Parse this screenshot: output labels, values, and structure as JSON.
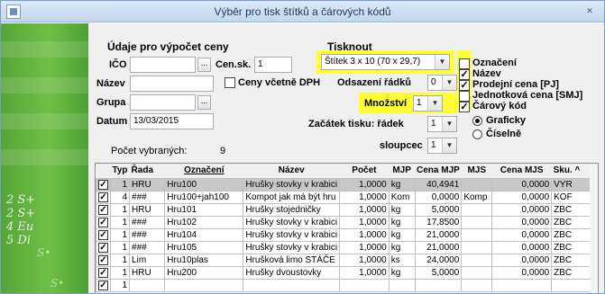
{
  "window": {
    "title": "Výběr pro tisk štítků a čárových kódů",
    "close_icon": "close-icon"
  },
  "left_panel": {
    "heading": "Údaje pro výpočet ceny",
    "ico_label": "IČO",
    "ico_value": "",
    "nazev_label": "Název",
    "nazev_value": "",
    "grupa_label": "Grupa",
    "grupa_value": "",
    "datum_label": "Datum",
    "datum_value": "13/03/2015",
    "browse_label": "...",
    "censk_label": "Cen.sk.",
    "censk_value": "1",
    "ceny_dph_label": "Ceny včetně DPH",
    "ceny_dph_checked": false,
    "pocet_label": "Počet vybraných:",
    "pocet_value": "9"
  },
  "print_panel": {
    "heading": "Tisknout",
    "label_type": "Štítek 3 x 10 (70 x 29,7)",
    "odsazeni_label": "Odsazení řádků",
    "odsazeni_value": "0",
    "mnozstvi_label": "Množství",
    "mnozstvi_value": "1",
    "zacatek_label": "Začátek tisku: řádek",
    "zacatek_value": "1",
    "sloupcec_label": "sloupcec",
    "sloupcec_value": "1"
  },
  "options": [
    {
      "label": "Označení",
      "checked": false
    },
    {
      "label": "Název",
      "checked": true
    },
    {
      "label": "Prodejní cena [PJ]",
      "checked": true
    },
    {
      "label": "Jednotková cena [SMJ]",
      "checked": false
    },
    {
      "label": "Čárový kód",
      "checked": true
    }
  ],
  "radio": {
    "graficky": "Graficky",
    "ciselne": "Číselně",
    "selected": "graficky"
  },
  "highlight_color": "#ffff33",
  "grid": {
    "columns": [
      "",
      "Typ",
      "Řada",
      "Označení",
      "Název",
      "Počet",
      "MJP",
      "Cena MJP",
      "MJS",
      "Cena MJS",
      "Sku."
    ],
    "sort_indicator": "^",
    "rows": [
      [
        "1",
        "HRU",
        "Hru100",
        "Hrušky stovky v krabici",
        "1,0000",
        "kg",
        "40,4941",
        "",
        "0,0000",
        "VYR"
      ],
      [
        "4",
        "###",
        "Hru100+jah100",
        "Kompot jak má být hru",
        "1,0000",
        "Kom",
        "0,0000",
        "Komp",
        "0,0000",
        "KOF"
      ],
      [
        "1",
        "HRU",
        "Hru101",
        "Hrušky stojedničky",
        "1,0000",
        "kg",
        "5,0000",
        "",
        "0,0000",
        "ZBC"
      ],
      [
        "1",
        "###",
        "Hru102",
        "Hrušky stovky v krabici",
        "1,0000",
        "kg",
        "17,8500",
        "",
        "0,0000",
        "ZBC"
      ],
      [
        "1",
        "###",
        "Hru104",
        "Hrušky stovky v krabici",
        "1,0000",
        "kg",
        "21,0000",
        "",
        "0,0000",
        "ZBC"
      ],
      [
        "1",
        "###",
        "Hru105",
        "Hrušky stovky v krabici",
        "1,0000",
        "kg",
        "21,0000",
        "",
        "0,0000",
        "ZBC"
      ],
      [
        "1",
        "Lim",
        "Hru10plas",
        "Hrušková limo STÁČE",
        "1,0000",
        "ks",
        "24,0000",
        "",
        "0,0000",
        "ZBC"
      ],
      [
        "1",
        "HRU",
        "Hru200",
        "Hrušky dvoustovky",
        "1,0000",
        "kg",
        "5,0000",
        "",
        "0,0000",
        "ZBC"
      ],
      [
        "1",
        "",
        "",
        "",
        "",
        "",
        "",
        "",
        "",
        ""
      ]
    ]
  },
  "side_text": [
    "2  S+",
    "2  S+",
    "4  Eu",
    "5  Di"
  ]
}
